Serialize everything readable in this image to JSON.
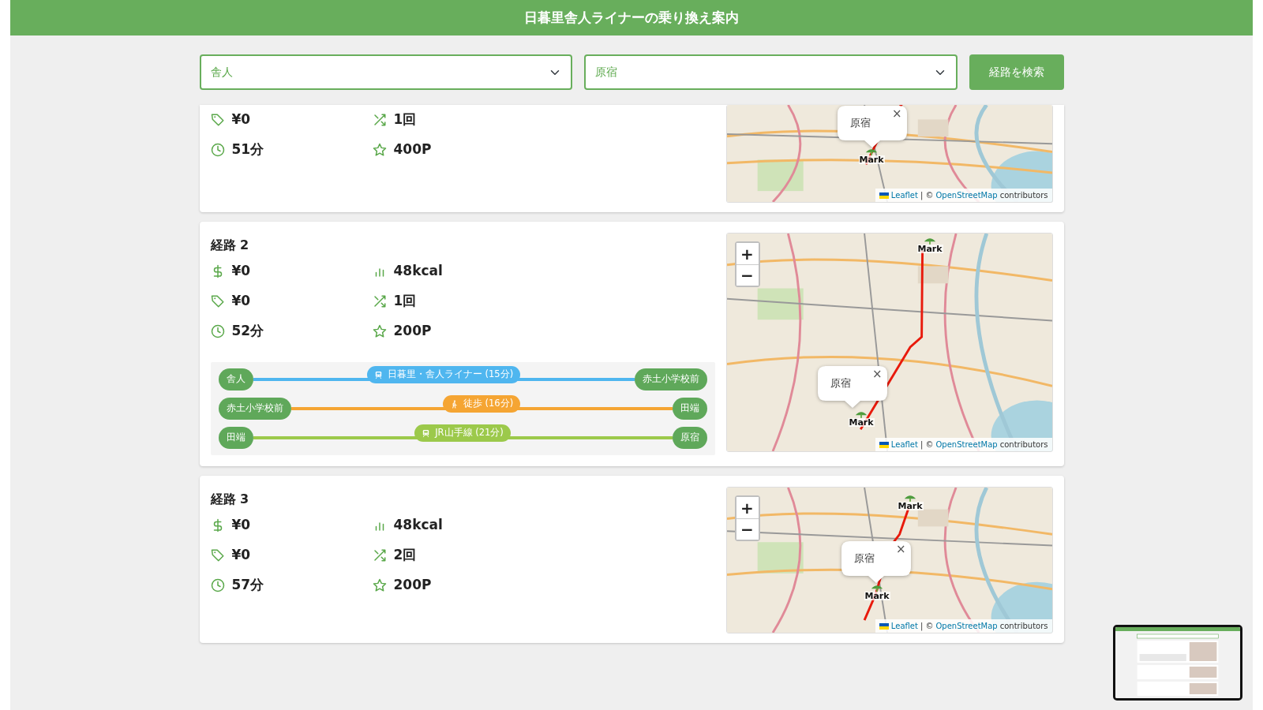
{
  "header": {
    "title": "日暮里舎人ライナーの乗り換え案内"
  },
  "search": {
    "from": "舎人",
    "to": "原宿",
    "button": "経路を検索"
  },
  "routes": [
    {
      "left_stats": [
        {
          "kind": "fare",
          "value": "¥0"
        },
        {
          "kind": "time",
          "value": "51分"
        }
      ],
      "right_stats": [
        {
          "kind": "transfers",
          "value": "1回"
        },
        {
          "kind": "points",
          "value": "400P"
        }
      ],
      "map": {
        "markers": [
          "Mark"
        ],
        "popup": "原宿",
        "popup_close": "×",
        "attribution": {
          "link1": "Leaflet",
          "separator": "| ©",
          "link2": "OpenStreetMap",
          "tail": "contributors"
        }
      }
    },
    {
      "title": "経路 2",
      "left_stats": [
        {
          "kind": "price",
          "value": "¥0"
        },
        {
          "kind": "fare",
          "value": "¥0"
        },
        {
          "kind": "time",
          "value": "52分"
        }
      ],
      "right_stats": [
        {
          "kind": "calories",
          "value": "48kcal"
        },
        {
          "kind": "transfers",
          "value": "1回"
        },
        {
          "kind": "points",
          "value": "200P"
        }
      ],
      "segments": [
        {
          "kind": "train",
          "from": "舎人",
          "to": "赤土小学校前",
          "label": "日暮里・舎人ライナー (15分)",
          "color": "#4fb6ef"
        },
        {
          "kind": "walk",
          "from": "赤土小学校前",
          "to": "田端",
          "label": "徒歩 (16分)",
          "color": "#f5a533"
        },
        {
          "kind": "train",
          "from": "田端",
          "to": "原宿",
          "label": "JR山手線 (21分)",
          "color": "#9cc94b"
        }
      ],
      "map": {
        "zoom_in": "+",
        "zoom_out": "−",
        "markers": [
          "Mark",
          "Mark"
        ],
        "popup": "原宿",
        "popup_close": "×",
        "attribution": {
          "link1": "Leaflet",
          "separator": "| ©",
          "link2": "OpenStreetMap",
          "tail": "contributors"
        }
      }
    },
    {
      "title": "経路 3",
      "left_stats": [
        {
          "kind": "price",
          "value": "¥0"
        },
        {
          "kind": "fare",
          "value": "¥0"
        },
        {
          "kind": "time",
          "value": "57分"
        }
      ],
      "right_stats": [
        {
          "kind": "calories",
          "value": "48kcal"
        },
        {
          "kind": "transfers",
          "value": "2回"
        },
        {
          "kind": "points",
          "value": "200P"
        }
      ],
      "map": {
        "zoom_in": "+",
        "zoom_out": "−",
        "markers": [
          "Mark",
          "Mark"
        ],
        "popup": "原宿",
        "popup_close": "×",
        "attribution": {
          "link1": "Leaflet",
          "separator": "| ©",
          "link2": "OpenStreetMap",
          "tail": "contributors"
        }
      }
    }
  ]
}
